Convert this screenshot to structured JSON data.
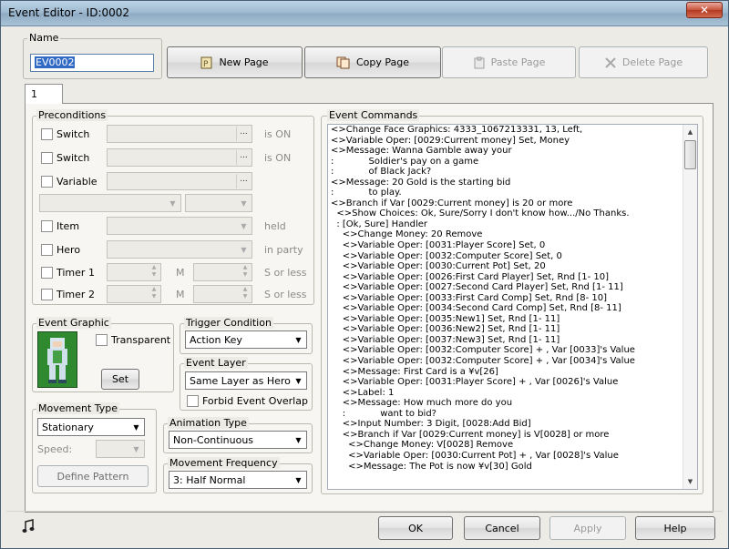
{
  "window": {
    "title": "Event Editor - ID:0002",
    "close_glyph": "✕"
  },
  "name": {
    "label": "Name",
    "value": "EV0002"
  },
  "toolbar": {
    "new_page": "New Page",
    "copy_page": "Copy Page",
    "paste_page": "Paste Page",
    "delete_page": "Delete Page"
  },
  "tabs": [
    {
      "label": "1"
    }
  ],
  "preconditions": {
    "title": "Preconditions",
    "switch1": {
      "label": "Switch",
      "suffix": "is ON",
      "dots": "..."
    },
    "switch2": {
      "label": "Switch",
      "suffix": "is ON",
      "dots": "..."
    },
    "variable": {
      "label": "Variable",
      "dots": "..."
    },
    "item": {
      "label": "Item",
      "suffix": "held"
    },
    "hero": {
      "label": "Hero",
      "suffix": "in party"
    },
    "timer1": {
      "label": "Timer 1",
      "unit": "M",
      "suffix": "S or less"
    },
    "timer2": {
      "label": "Timer 2",
      "unit": "M",
      "suffix": "S or less"
    }
  },
  "event_graphic": {
    "title": "Event Graphic",
    "transparent": "Transparent",
    "set": "Set"
  },
  "trigger": {
    "title": "Trigger Condition",
    "value": "Action Key"
  },
  "event_layer": {
    "title": "Event Layer",
    "value": "Same Layer as Hero",
    "forbid_overlap": "Forbid Event Overlap"
  },
  "movement_type": {
    "title": "Movement Type",
    "value": "Stationary",
    "speed_label": "Speed:",
    "define_pattern": "Define Pattern"
  },
  "animation_type": {
    "title": "Animation Type",
    "value": "Non-Continuous"
  },
  "movement_frequency": {
    "title": "Movement Frequency",
    "value": "3: Half Normal"
  },
  "commands": {
    "title": "Event Commands",
    "lines": [
      "<>Change Face Graphics: 4333_1067213331, 13, Left,",
      "<>Variable Oper: [0029:Current money] Set, Money",
      "<>Message: Wanna Gamble away your",
      ":            Soldier's pay on a game",
      ":            of Black Jack?",
      "<>Message: 20 Gold is the starting bid",
      ":            to play.",
      "<>Branch if Var [0029:Current money] is 20 or more",
      "  <>Show Choices: Ok, Sure/Sorry I don't know how.../No Thanks.",
      "  : [Ok, Sure] Handler",
      "    <>Change Money: 20 Remove",
      "    <>Variable Oper: [0031:Player Score] Set, 0",
      "    <>Variable Oper: [0032:Computer Score] Set, 0",
      "    <>Variable Oper: [0030:Current Pot] Set, 20",
      "    <>Variable Oper: [0026:First Card Player] Set, Rnd [1- 10]",
      "    <>Variable Oper: [0027:Second Card Player] Set, Rnd [1- 11]",
      "    <>Variable Oper: [0033:First Card Comp] Set, Rnd [8- 10]",
      "    <>Variable Oper: [0034:Second Card Comp] Set, Rnd [8- 11]",
      "    <>Variable Oper: [0035:New1] Set, Rnd [1- 11]",
      "    <>Variable Oper: [0036:New2] Set, Rnd [1- 11]",
      "    <>Variable Oper: [0037:New3] Set, Rnd [1- 11]",
      "    <>Variable Oper: [0032:Computer Score] + , Var [0033]'s Value",
      "    <>Variable Oper: [0032:Computer Score] + , Var [0034]'s Value",
      "    <>Message: First Card is a ¥v[26]",
      "    <>Variable Oper: [0031:Player Score] + , Var [0026]'s Value",
      "    <>Label: 1",
      "    <>Message: How much more do you",
      "    :            want to bid?",
      "    <>Input Number: 3 Digit, [0028:Add Bid]",
      "    <>Branch if Var [0029:Current money] is V[0028] or more",
      "      <>Change Money: V[0028] Remove",
      "      <>Variable Oper: [0030:Current Pot] + , Var [0028]'s Value",
      "      <>Message: The Pot is now ¥v[30] Gold"
    ]
  },
  "footer": {
    "ok": "OK",
    "cancel": "Cancel",
    "apply": "Apply",
    "help": "Help"
  }
}
